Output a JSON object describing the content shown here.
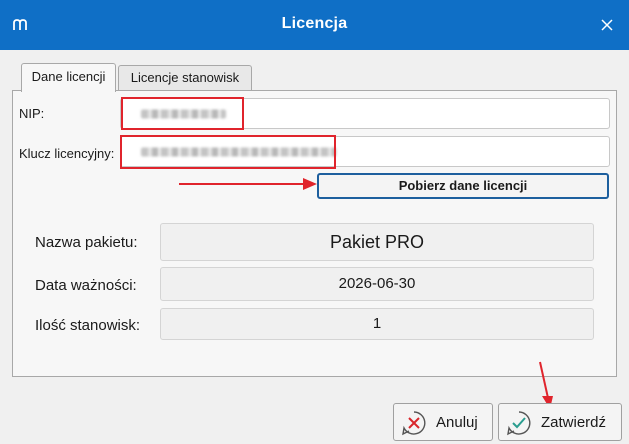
{
  "window": {
    "title": "Licencja"
  },
  "tabs": [
    {
      "label": "Dane licencji",
      "active": true
    },
    {
      "label": "Licencje stanowisk",
      "active": false
    }
  ],
  "form": {
    "nip_label": "NIP:",
    "key_label": "Klucz licencyjny:",
    "fetch_button": "Pobierz dane licencji"
  },
  "info": {
    "package_label": "Nazwa pakietu:",
    "package_value": "Pakiet PRO",
    "expiry_label": "Data ważności:",
    "expiry_value": "2026-06-30",
    "seats_label": "Ilość stanowisk:",
    "seats_value": "1"
  },
  "buttons": {
    "cancel": "Anuluj",
    "confirm": "Zatwierdź"
  },
  "colors": {
    "titlebar": "#0f6fc6",
    "annotation": "#e0242c",
    "cancel_icon": "#d9262c",
    "confirm_icon": "#2a9d8f"
  }
}
